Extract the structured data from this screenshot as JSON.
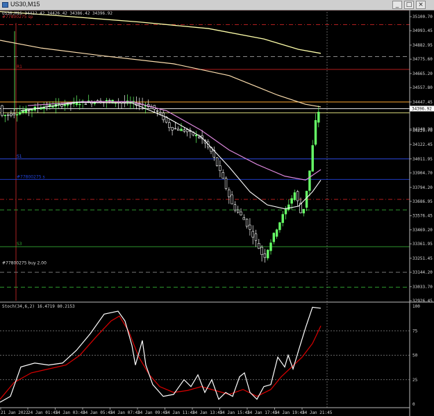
{
  "window": {
    "title": "US30,M15",
    "min_label": "_",
    "max_label": "□",
    "close_label": "×"
  },
  "chart_info": "US30,M15  34412.42 34426.42 34386.42 34396.92",
  "colors": {
    "background": "#000000",
    "bull": "#66ff66",
    "bear": "#ffffff",
    "ma_long": "#ffffaa",
    "ma_mid": "#ffe0b0",
    "ma_slow": "#dd88dd",
    "ma_fast": "#ffffff",
    "stoch_main": "#ffffff",
    "stoch_signal": "#dd0000"
  },
  "price_levels": [
    {
      "value": 34396.92,
      "color": "#ffffff",
      "style": "solid",
      "label": ""
    },
    {
      "value": 34447.45,
      "color": "#ffaa33",
      "style": "solid",
      "label": ""
    },
    {
      "value": 34365.0,
      "color": "#eeee88",
      "style": "solid",
      "label": ""
    },
    {
      "value": 34697.0,
      "color": "#cc2222",
      "style": "solid",
      "label": "R1"
    },
    {
      "value": 34011.95,
      "color": "#3355ff",
      "style": "solid",
      "label": "S1"
    },
    {
      "value": 33855.0,
      "color": "#2244dd",
      "style": "solid",
      "label": "#77800275 s"
    },
    {
      "value": 35040.0,
      "color": "#cc2222",
      "style": "dashdot",
      "label": ""
    },
    {
      "value": 34795.0,
      "color": "#888888",
      "style": "dash",
      "label": ""
    },
    {
      "value": 33702.0,
      "color": "#cc2222",
      "style": "dashdot",
      "label": ""
    },
    {
      "value": 33622.0,
      "color": "#33aa33",
      "style": "dash",
      "label": ""
    },
    {
      "value": 33340.0,
      "color": "#33aa33",
      "style": "solid",
      "label": "S3"
    },
    {
      "value": 33144.2,
      "color": "#888888",
      "style": "dash",
      "label": ""
    },
    {
      "value": 33030.0,
      "color": "#33aa33",
      "style": "dash",
      "label": ""
    },
    {
      "value": 35150.0,
      "color": "#cc2222",
      "style": "solid",
      "label": ""
    }
  ],
  "order_labels": [
    {
      "text": "#77800275 sp",
      "value": 35080.0,
      "color": "#cc3333"
    },
    {
      "text": "#77800275 buy 2.00",
      "value": 33196.0,
      "color": "#dddddd"
    }
  ],
  "current_price": "34396.92",
  "price_axis": [
    "35100.70",
    "34993.45",
    "34882.95",
    "34775.60",
    "34665.20",
    "34557.80",
    "34447.45",
    "34240.20",
    "34229.70",
    "34122.45",
    "34011.95",
    "33904.70",
    "33794.20",
    "33686.95",
    "33576.45",
    "33469.20",
    "33361.95",
    "33251.45",
    "33144.20",
    "33033.70",
    "32926.45"
  ],
  "stoch": {
    "label": "Stoch(34,6,2) 16.4719 80.2153",
    "levels": [
      "100",
      "75",
      "50",
      "25",
      "0"
    ]
  },
  "time_axis": [
    "21 Jan 2022",
    "24 Jan 01:45",
    "24 Jan 03:45",
    "24 Jan 05:45",
    "24 Jan 07:45",
    "24 Jan 09:45",
    "24 Jan 11:45",
    "24 Jan 13:45",
    "24 Jan 15:45",
    "24 Jan 17:45",
    "24 Jan 19:45",
    "24 Jan 21:45"
  ]
}
